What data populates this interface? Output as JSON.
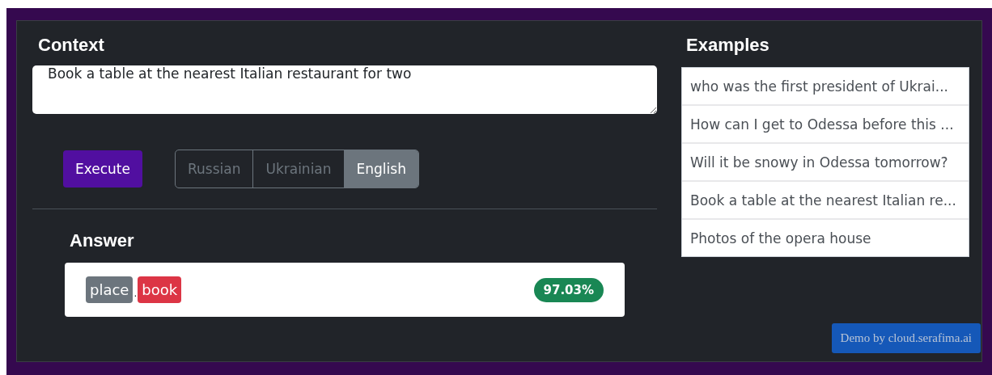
{
  "context": {
    "title": "Context",
    "value": "Book a table at the nearest Italian restaurant for two"
  },
  "execute_button": "Execute",
  "languages": [
    {
      "label": "Russian",
      "selected": false
    },
    {
      "label": "Ukrainian",
      "selected": false
    },
    {
      "label": "English",
      "selected": true
    }
  ],
  "answer": {
    "title": "Answer",
    "tags": [
      {
        "label": "place",
        "color": "#6c757d"
      },
      {
        "label": "book",
        "color": "#dc3545"
      }
    ],
    "separator": ".",
    "confidence": "97.03%"
  },
  "examples": {
    "title": "Examples",
    "items": [
      "who was the first president of Ukrai...",
      "How can I get to Odessa before this ...",
      "Will it be snowy in Odessa tomorrow?",
      "Book a table at the nearest Italian re...",
      "Photos of the opera house"
    ]
  },
  "credit": "Demo by cloud.serafima.ai"
}
